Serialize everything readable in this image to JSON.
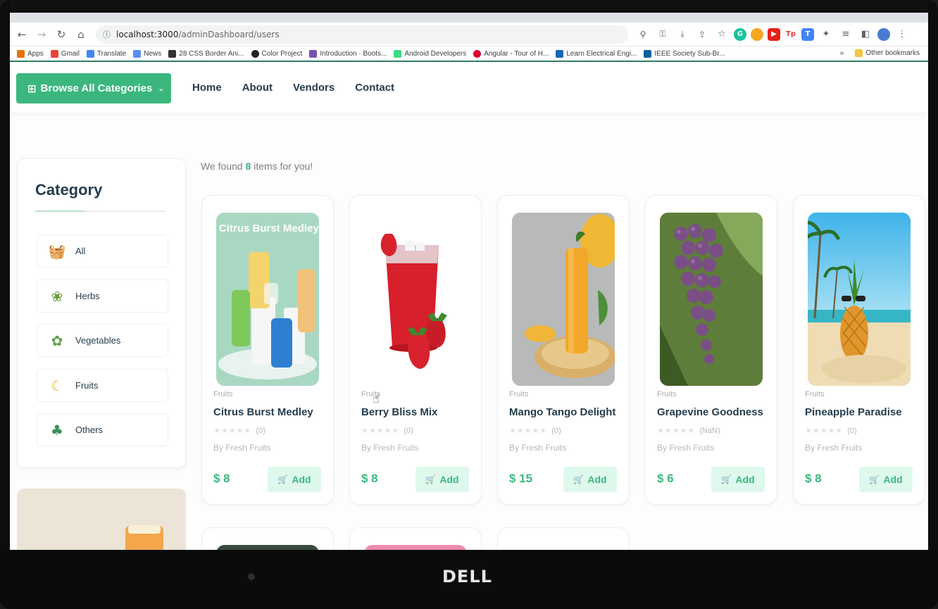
{
  "browser": {
    "url_host": "localhost:3000",
    "url_path": "/adminDashboard/users",
    "bookmarks": [
      "Apps",
      "Gmail",
      "Translate",
      "News",
      "28 CSS Border Ani...",
      "Color Project",
      "Introduction · Boots...",
      "Android Developers",
      "Angular - Tour of H...",
      "Learn Electrical Engi...",
      "IEEE Society Sub-Br..."
    ],
    "bookmarks_more": "»",
    "other_bookmarks": "Other bookmarks"
  },
  "nav": {
    "browse_label": "Browse All Categories",
    "links": [
      "Home",
      "About",
      "Vendors",
      "Contact"
    ]
  },
  "results": {
    "prefix": "We found",
    "count": "8",
    "suffix": "items for you!"
  },
  "sidebar": {
    "title": "Category",
    "items": [
      {
        "label": "All",
        "icon": "basket-icon"
      },
      {
        "label": "Herbs",
        "icon": "herbs-icon"
      },
      {
        "label": "Vegetables",
        "icon": "vegetables-icon"
      },
      {
        "label": "Fruits",
        "icon": "fruits-icon"
      },
      {
        "label": "Others",
        "icon": "others-icon"
      }
    ]
  },
  "products": [
    {
      "category": "Fruits",
      "name": "Citrus Burst Medley",
      "rating": "(0)",
      "vendor": "By Fresh Fruits",
      "price": "$ 8",
      "add": "Add",
      "image_caption": "Citrus Burst Medley"
    },
    {
      "category": "Fruits",
      "name": "Berry Bliss Mix",
      "rating": "(0)",
      "vendor": "By Fresh Fruits",
      "price": "$ 8",
      "add": "Add"
    },
    {
      "category": "Fruits",
      "name": "Mango Tango Delight",
      "rating": "(0)",
      "vendor": "By Fresh Fruits",
      "price": "$ 15",
      "add": "Add"
    },
    {
      "category": "Fruits",
      "name": "Grapevine Goodness",
      "rating": "(NaN)",
      "vendor": "By Fresh Fruits",
      "price": "$ 6",
      "add": "Add"
    },
    {
      "category": "Fruits",
      "name": "Pineapple Paradise",
      "rating": "(0)",
      "vendor": "By Fresh Fruits",
      "price": "$ 8",
      "add": "Add"
    }
  ],
  "monitor": {
    "brand": "DELL"
  },
  "colors": {
    "accent": "#3bb77e",
    "accent_light": "#def9ec",
    "heading": "#253d4e"
  }
}
